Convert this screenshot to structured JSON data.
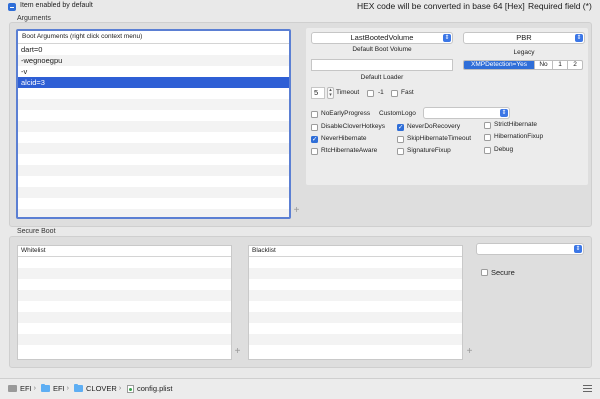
{
  "header": {
    "enabled_label": "Item enabled by default",
    "hex_info": "HEX code will be converted in base 64 [Hex]",
    "required_info": "Required field (*)"
  },
  "arguments": {
    "section_label": "Arguments",
    "boot_args": {
      "header": "Boot Arguments (right click context menu)",
      "items": [
        "dart=0",
        "-wegnoegpu",
        "-v",
        "alcid=3"
      ],
      "selected_index": 3
    },
    "default_boot_volume": {
      "value": "LastBootedVolume",
      "caption": "Default Boot Volume"
    },
    "legacy": {
      "value": "PBR",
      "caption": "Legacy"
    },
    "default_loader": {
      "value": "",
      "caption": "Default Loader"
    },
    "xmp_segments": [
      "XMPDetection=Yes",
      "No",
      "1",
      "2"
    ],
    "timeout": {
      "value": "5",
      "label": "Timeout"
    },
    "minus_one_label": "-1",
    "fast_label": "Fast",
    "no_early_progress": "NoEarlyProgress",
    "custom_logo": {
      "label": "CustomLogo",
      "value": ""
    },
    "checkboxes": [
      {
        "label": "DisableCloverHotkeys",
        "checked": false
      },
      {
        "label": "NeverDoRecovery",
        "checked": true
      },
      {
        "label": "StrictHibernate",
        "checked": false
      },
      {
        "label": "NeverHibernate",
        "checked": true
      },
      {
        "label": "SkipHibernateTimeout",
        "checked": false
      },
      {
        "label": "HibernationFixup",
        "checked": false
      },
      {
        "label": "RtcHibernateAware",
        "checked": false
      },
      {
        "label": "SignatureFixup",
        "checked": false
      },
      {
        "label": "Debug",
        "checked": false
      }
    ]
  },
  "secure_boot": {
    "section_label": "Secure Boot",
    "whitelist_header": "Whitelist",
    "blacklist_header": "Blacklist",
    "policy_value": "",
    "secure_label": "Secure"
  },
  "pathbar": {
    "crumbs": [
      "EFI",
      "EFI",
      "CLOVER",
      "config.plist"
    ],
    "separator": "›"
  },
  "icons": {
    "popup_arrow": "chevron-updown-icon",
    "add": "plus-icon",
    "folder": "folder-icon",
    "disk": "disk-icon",
    "file": "plist-file-icon",
    "menu": "hamburger-icon"
  },
  "colors": {
    "accent": "#2f6ed8",
    "selection": "#2e5fd5",
    "folder": "#5eaef3"
  }
}
